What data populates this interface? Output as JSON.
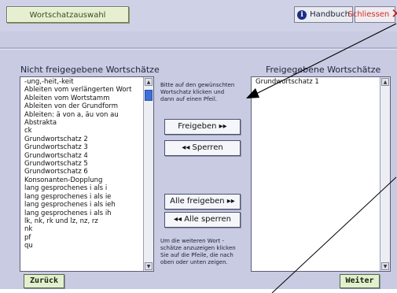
{
  "header": {
    "title_button": "Wortschatzauswahl",
    "help_button": "Handbuch",
    "close_button": "Schliessen"
  },
  "left_panel": {
    "label": "Nicht freigegebene Wortschätze",
    "items": [
      "-ung,-heit,-keit",
      "Ableiten vom verlängerten Wort",
      "Ableiten vom Wortstamm",
      "Ableiten von der Grundform",
      "Ableiten: ä von a, äu von au",
      "Abstrakta",
      "ck",
      "Grundwortschatz 2",
      "Grundwortschatz 3",
      "Grundwortschatz 4",
      "Grundwortschatz 5",
      "Grundwortschatz 6",
      "Konsonanten-Dopplung",
      "lang gesprochenes i als i",
      "lang gesprochenes i als ie",
      "lang gesprochenes i als ieh",
      "lang gesprochenes i als ih",
      "lk, nk, rk und lz, nz, rz",
      "nk",
      "pf",
      "qu"
    ]
  },
  "right_panel": {
    "label": "Freigegebene Wortschätze",
    "items": [
      "Grundwortschatz 1"
    ]
  },
  "middle": {
    "hint_top": [
      "Bitte auf den gewünschten",
      "Wortschatz klicken und",
      "dann auf einen Pfeil."
    ],
    "release_button": "Freigeben  ▸▸",
    "lock_button": "◂◂  Sperren",
    "release_all_button": "Alle freigeben ▸▸",
    "lock_all_button": "◂◂ Alle sperren",
    "hint_bottom": [
      "Um die weiteren Wort -",
      "schätze anzuzeigen klicken",
      "Sie auf die Pfeile, die nach",
      "oben oder unten zeigen."
    ]
  },
  "footer": {
    "back_button": "Zurück",
    "next_button": "Weiter"
  },
  "colors": {
    "background": "#c9cbe2",
    "close_accent": "#d02b2b",
    "nav_button": "#e2efd0",
    "scroll_thumb": "#3d6fd9"
  }
}
